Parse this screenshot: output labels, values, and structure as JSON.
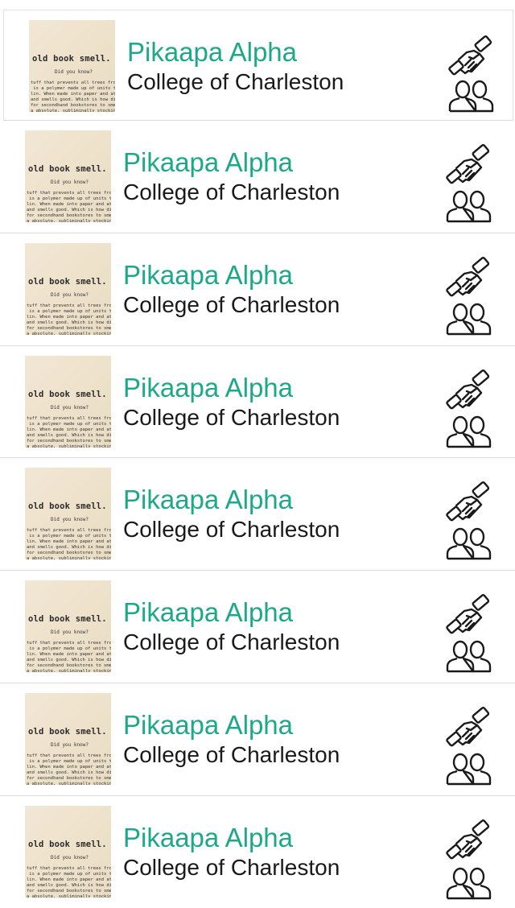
{
  "thumbnail": {
    "title": "old book smell.",
    "subtitle": "Did you know?",
    "body": "tuff that prevents all trees from\n is a polymer made up of units th\nlin. When made into paper and at\nand smells good. Which is how di\nfor secondhand bookstores to sme\na absolute, subliminally stocking"
  },
  "items": [
    {
      "name": "Pikaapa Alpha",
      "school": "College of Charleston",
      "icons": [
        "handshake-icon",
        "group-icon"
      ]
    },
    {
      "name": "Pikaapa Alpha",
      "school": "College of Charleston",
      "icons": [
        "handshake-icon",
        "group-icon"
      ]
    },
    {
      "name": "Pikaapa Alpha",
      "school": "College of Charleston",
      "icons": [
        "handshake-icon",
        "group-icon"
      ]
    },
    {
      "name": "Pikaapa Alpha",
      "school": "College of Charleston",
      "icons": [
        "handshake-icon",
        "group-icon"
      ]
    },
    {
      "name": "Pikaapa Alpha",
      "school": "College of Charleston",
      "icons": [
        "handshake-icon",
        "group-icon"
      ]
    },
    {
      "name": "Pikaapa Alpha",
      "school": "College of Charleston",
      "icons": [
        "handshake-icon",
        "group-icon"
      ]
    },
    {
      "name": "Pikaapa Alpha",
      "school": "College of Charleston",
      "icons": [
        "handshake-icon",
        "group-icon"
      ]
    },
    {
      "name": "Pikaapa Alpha",
      "school": "College of Charleston",
      "icons": [
        "handshake-icon",
        "group-icon"
      ]
    }
  ],
  "colors": {
    "name": "#1ea88a",
    "school": "#1a1a1a",
    "divider": "#dcdcdc",
    "icon": "#1a1a1a"
  }
}
